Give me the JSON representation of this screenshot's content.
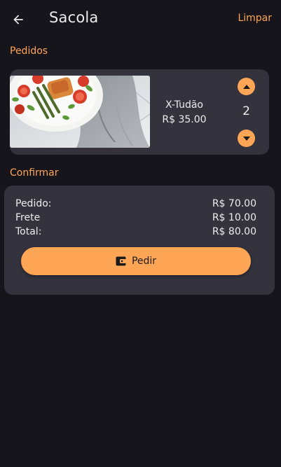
{
  "header": {
    "back_icon": "arrow-left-icon",
    "title": "Sacola",
    "clear_label": "Limpar"
  },
  "orders": {
    "section_label": "Pedidos",
    "items": [
      {
        "name": "X-Tudão",
        "price": "R$ 35.00",
        "quantity": "2",
        "image_icon": "food-photo"
      }
    ]
  },
  "confirm": {
    "section_label": "Confirmar",
    "rows": [
      {
        "label": "Pedido:",
        "value": "R$ 70.00"
      },
      {
        "label": "Frete",
        "value": "R$ 10.00"
      },
      {
        "label": "Total:",
        "value": "R$ 80.00"
      }
    ],
    "button_label": "Pedir",
    "button_icon": "wallet-icon"
  },
  "colors": {
    "background": "#17151c",
    "card": "#33323d",
    "accent": "#ffa556",
    "text": "#ececec"
  }
}
